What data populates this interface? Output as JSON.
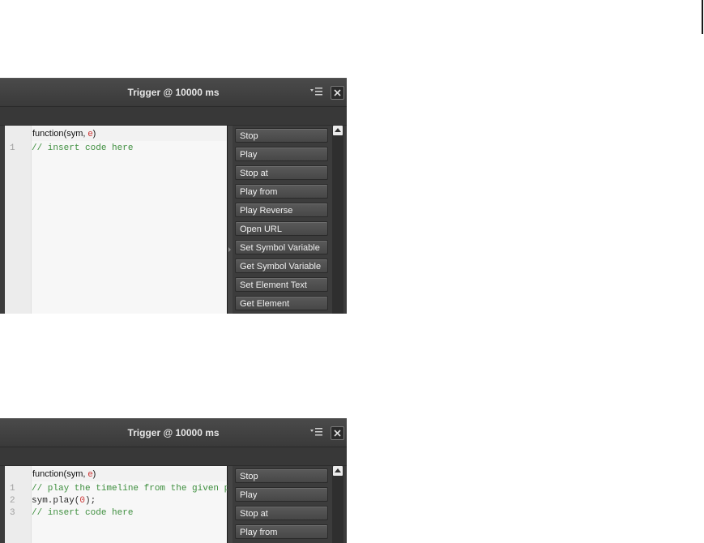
{
  "panels": [
    {
      "title": "Trigger @ 10000 ms",
      "function_sig": {
        "prefix": "function(sym, ",
        "param": "e",
        "suffix": ")"
      },
      "code_lines": [
        {
          "num": "1",
          "parts": [
            {
              "text": "// insert code here",
              "kind": "comment"
            }
          ]
        }
      ],
      "actions": [
        "Stop",
        "Play",
        "Stop at",
        "Play from",
        "Play Reverse",
        "Open URL",
        "Set Symbol Variable",
        "Get Symbol Variable",
        "Set Element Text",
        "Get Element"
      ]
    },
    {
      "title": "Trigger @ 10000 ms",
      "function_sig": {
        "prefix": "function(sym, ",
        "param": "e",
        "suffix": ")"
      },
      "code_lines": [
        {
          "num": "1",
          "parts": [
            {
              "text": "// play the timeline from the given p",
              "kind": "comment"
            }
          ]
        },
        {
          "num": "2",
          "parts": [
            {
              "text": "sym.play(",
              "kind": "code"
            },
            {
              "text": "0",
              "kind": "num"
            },
            {
              "text": ");",
              "kind": "code"
            }
          ]
        },
        {
          "num": "3",
          "parts": [
            {
              "text": "// insert code here",
              "kind": "comment"
            }
          ]
        }
      ],
      "actions": [
        "Stop",
        "Play",
        "Stop at",
        "Play from"
      ]
    }
  ],
  "icons": {
    "menu": "panel-menu-icon",
    "close": "close-icon",
    "scroll_up": "scroll-up-arrow-icon"
  },
  "colors": {
    "panel_bg": "#3c3c3c",
    "editor_bg": "#f7f7f7",
    "comment": "#3f8f3f",
    "number": "#cc3333"
  }
}
